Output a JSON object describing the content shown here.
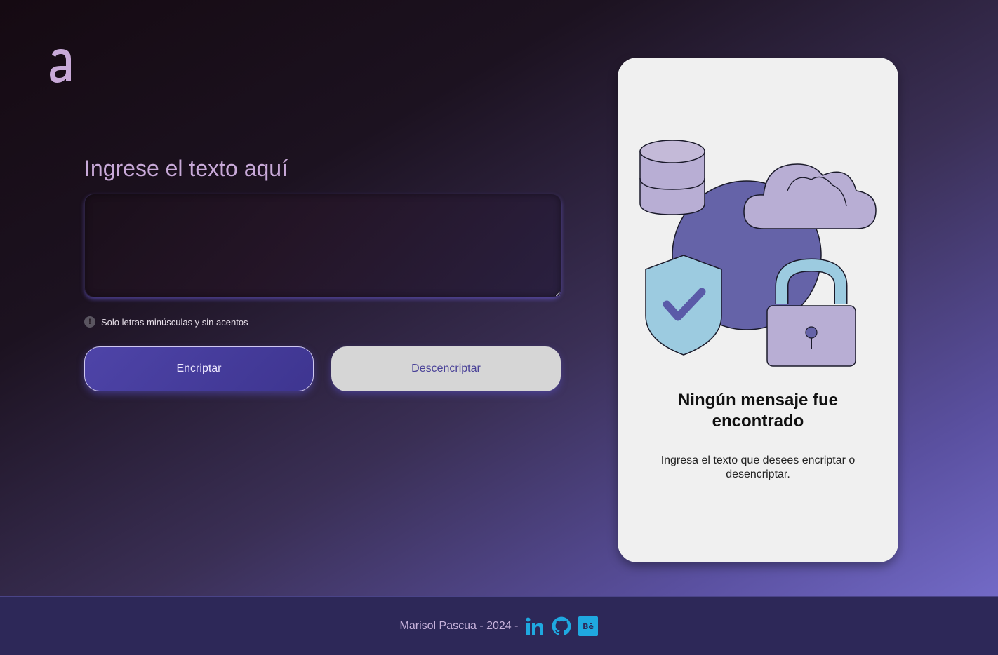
{
  "logo": {
    "icon": "letter-a-logo",
    "letter": "a"
  },
  "form": {
    "title": "Ingrese el texto aquí",
    "input_value": "",
    "input_placeholder": "",
    "hint": "Solo letras minúsculas y sin acentos",
    "hint_icon": "!"
  },
  "buttons": {
    "encrypt": "Encriptar",
    "decrypt": "Descencriptar"
  },
  "result_card": {
    "title": "Ningún mensaje fue encontrado",
    "description": "Ingresa el texto que desees encriptar o desencriptar.",
    "illustration": "security-illustration"
  },
  "footer": {
    "text": "Marisol Pascua - 2024 -",
    "links": [
      {
        "name": "linkedin",
        "icon": "linkedin-icon"
      },
      {
        "name": "github",
        "icon": "github-icon"
      },
      {
        "name": "behance",
        "icon": "behance-icon",
        "glyph": "Bē"
      }
    ]
  },
  "colors": {
    "accent": "#c8a9d8",
    "primary_button": "#4a40a0",
    "secondary_button": "#d6d6d6",
    "card_bg": "#f0f0f0",
    "footer_bg": "#2d2858",
    "social_icon": "#1fa8e0"
  }
}
